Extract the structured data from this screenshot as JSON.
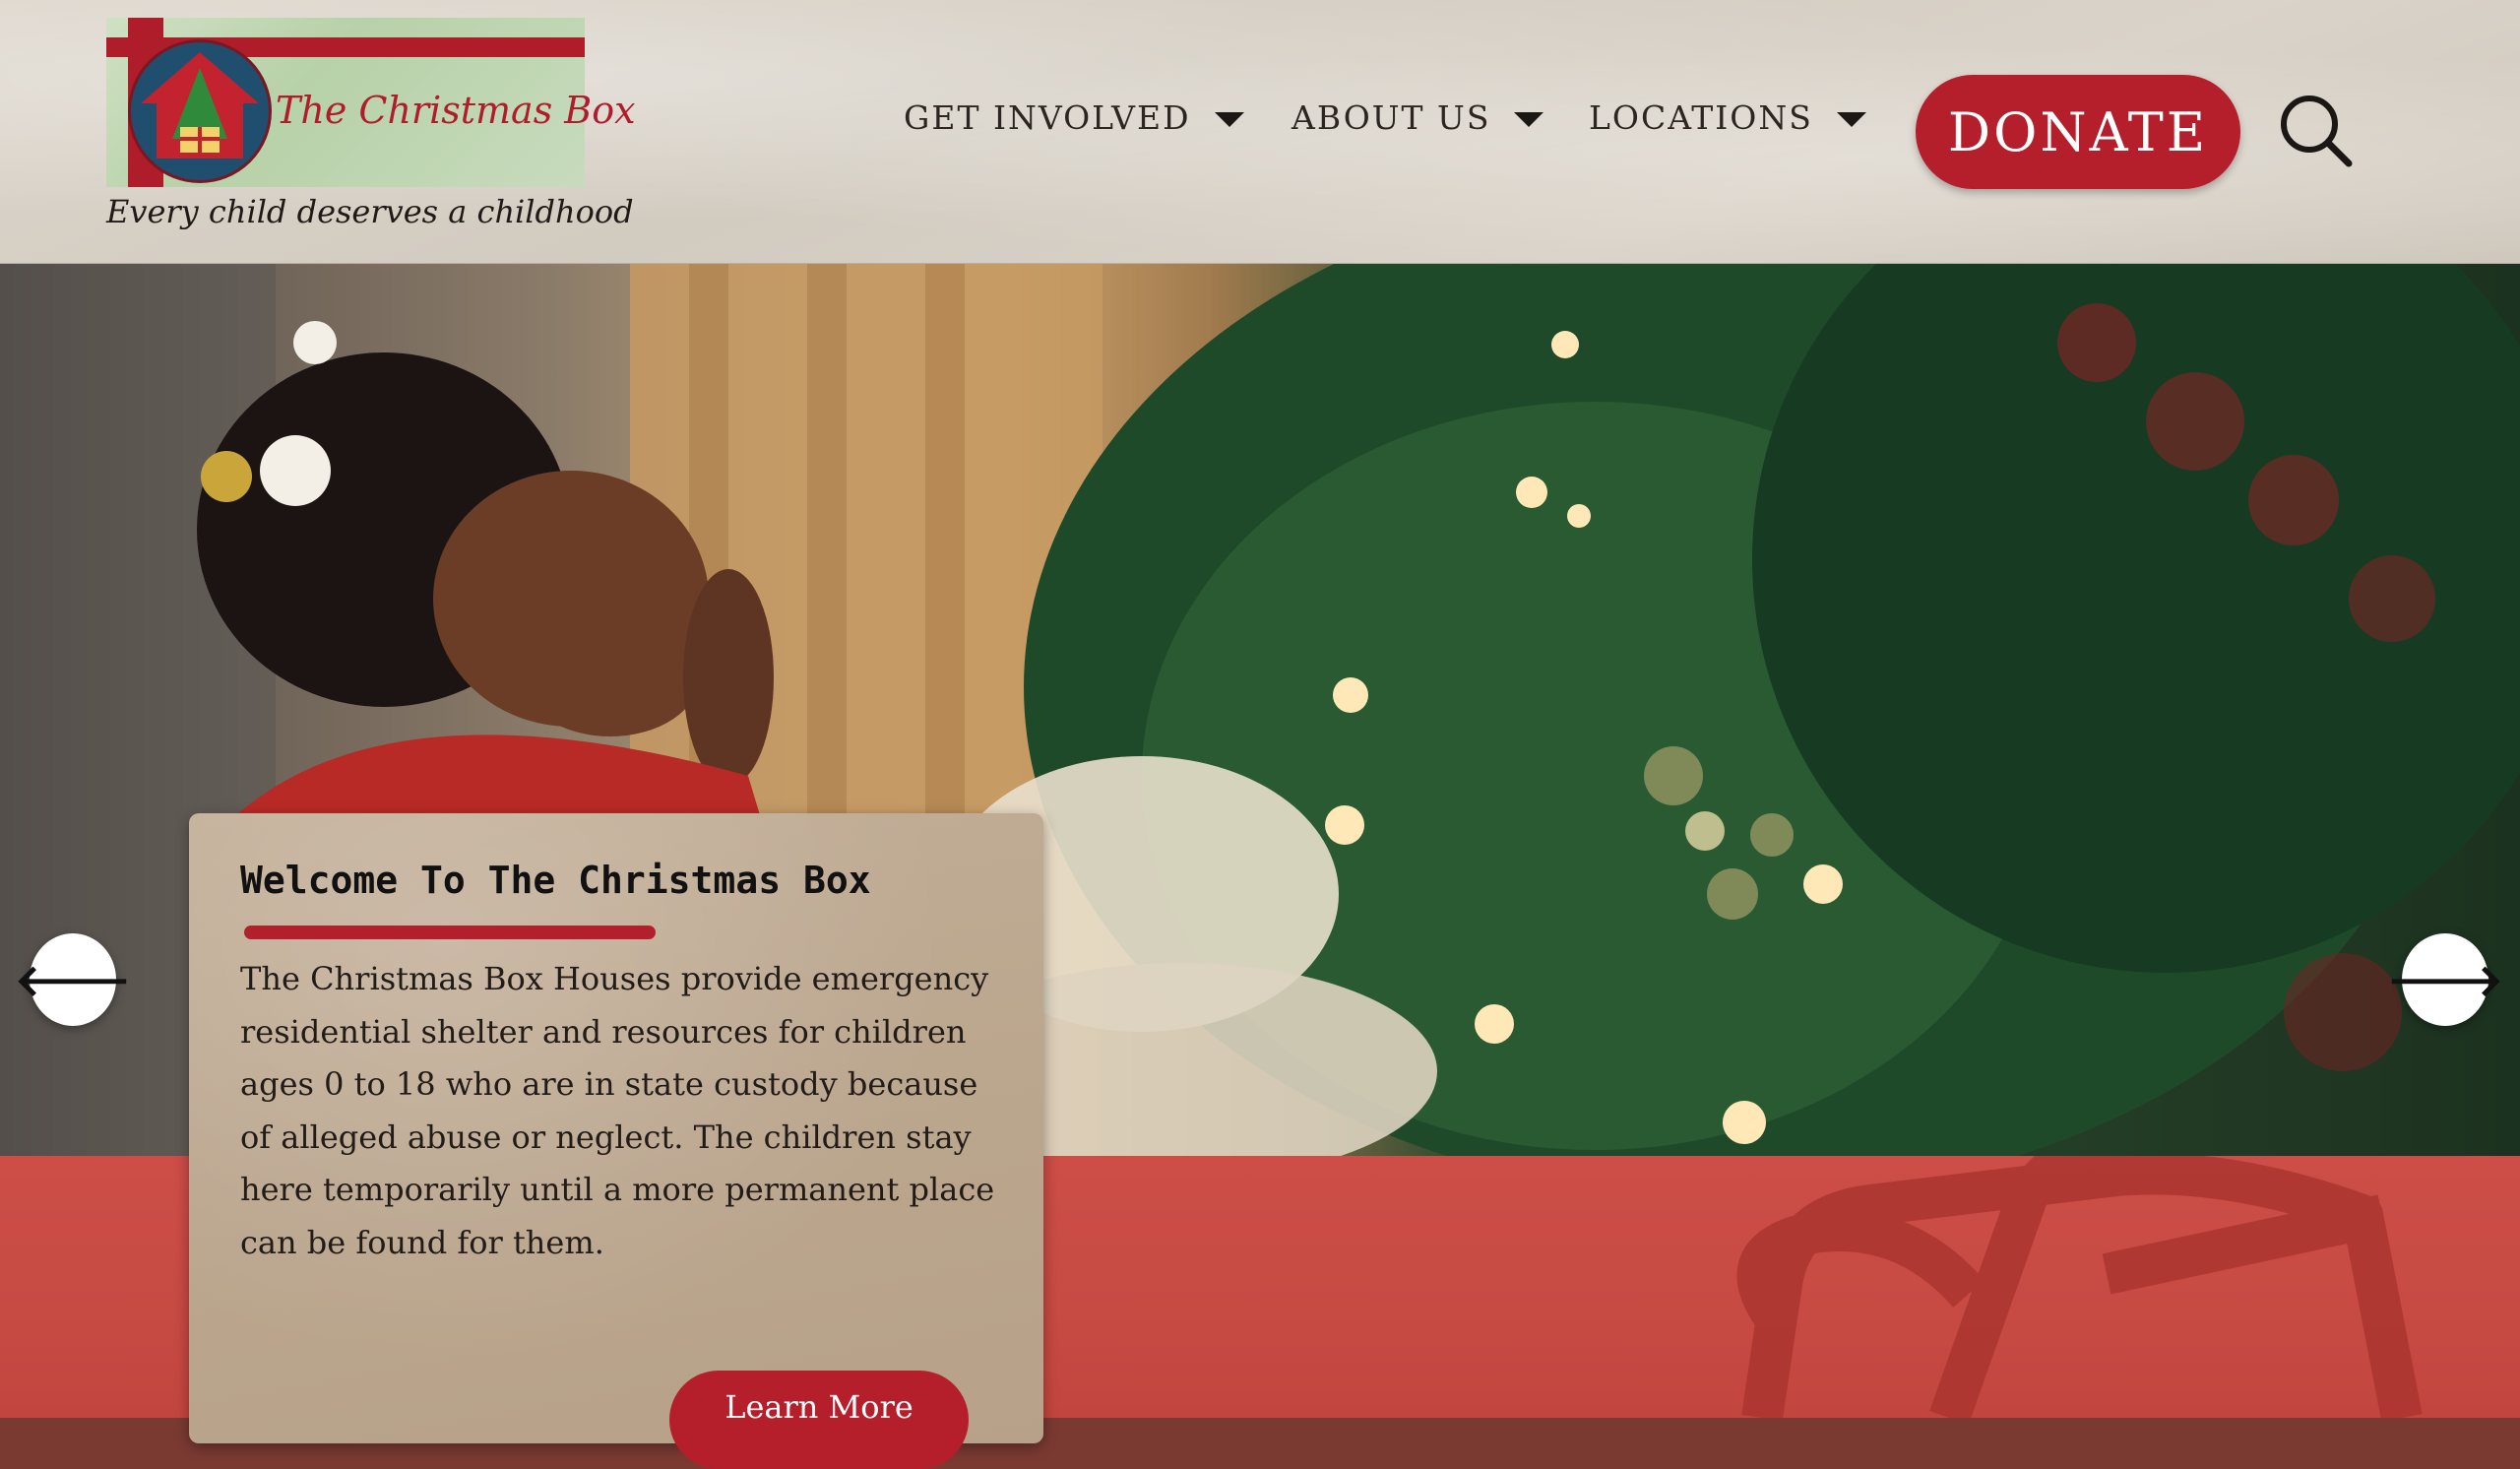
{
  "brand": {
    "logo_name": "The Christmas Box",
    "tagline": "Every child deserves a childhood"
  },
  "nav": {
    "items": [
      {
        "label": "GET INVOLVED",
        "icon": "caret-down-icon"
      },
      {
        "label": "ABOUT US",
        "icon": "caret-down-icon"
      },
      {
        "label": "LOCATIONS",
        "icon": "caret-down-icon"
      }
    ],
    "donate_label": "DONATE",
    "search_icon": "search-icon"
  },
  "hero": {
    "prev_icon": "arrow-left-icon",
    "next_icon": "arrow-right-icon",
    "prev_glyph": "🡐",
    "next_glyph": "🡒"
  },
  "welcome": {
    "title": "Welcome To The Christmas Box",
    "lines": [
      "The Christmas Box Houses provide emergency",
      "residential shelter and resources for children",
      "ages 0 to 18 who are in state custody because",
      "of alleged abuse or neglect. The children stay",
      "here temporarily until a more permanent place",
      "can be found for them."
    ],
    "button_label": "Learn More"
  },
  "colors": {
    "brand_red": "#b51f2c",
    "band_red": "#c74a43",
    "paper": "#d6cfc5",
    "card": "#bba68e"
  }
}
